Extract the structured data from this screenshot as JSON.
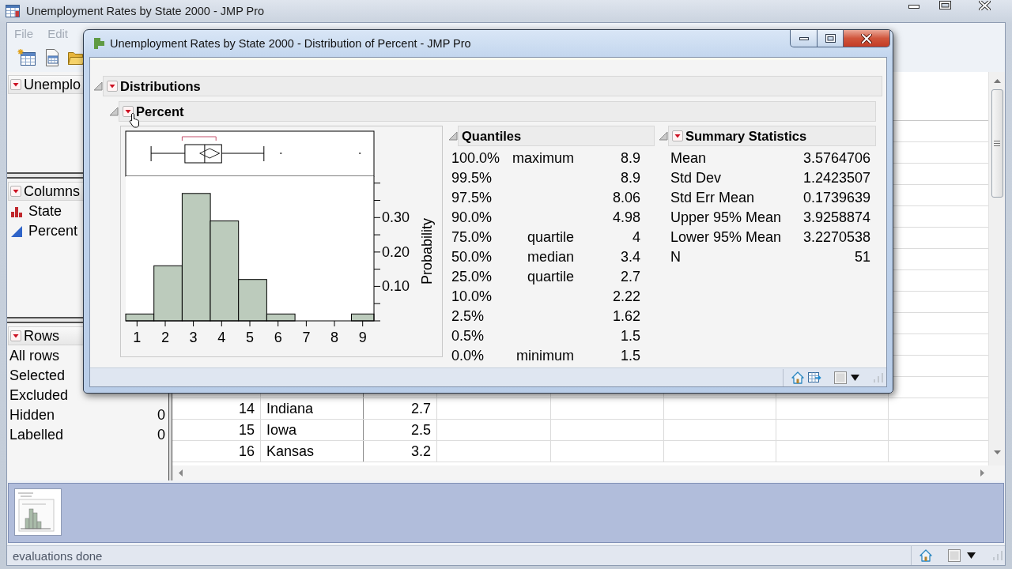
{
  "window": {
    "title": "Unemployment Rates by State 2000 - JMP Pro"
  },
  "menu_bar": [
    {
      "label": "File",
      "disabled": true
    },
    {
      "label": "Edit",
      "disabled": true
    }
  ],
  "table_panel": {
    "title": "Unemplo"
  },
  "columns_panel": {
    "title": "Columns",
    "columns": [
      {
        "name": "State",
        "kind": "nominal"
      },
      {
        "name": "Percent",
        "kind": "continuous"
      }
    ]
  },
  "rows_panel": {
    "title": "Rows",
    "stats": [
      {
        "label": "All rows"
      },
      {
        "label": "Selected"
      },
      {
        "label": "Excluded"
      },
      {
        "label": "Hidden",
        "value": "0"
      },
      {
        "label": "Labelled",
        "value": "0"
      }
    ]
  },
  "data_table": {
    "rows": [
      {
        "row_number": "14",
        "cells": [
          "Indiana",
          "2.7"
        ]
      },
      {
        "row_number": "15",
        "cells": [
          "Iowa",
          "2.5"
        ]
      },
      {
        "row_number": "16",
        "cells": [
          "Kansas",
          "3.2"
        ]
      }
    ]
  },
  "status_bar": {
    "text": "evaluations done"
  },
  "report_window": {
    "title": "Unemployment Rates by State 2000 - Distribution of Percent - JMP Pro",
    "report": {
      "title": "Distributions",
      "expanded": true,
      "variable": {
        "title": "Percent",
        "expanded": true,
        "chart_data": {
          "type": "bar",
          "ylabel": "Probability",
          "x": [
            1.1,
            2.1,
            3.1,
            4.1,
            5.1,
            6.1,
            7.1,
            8.1,
            9.1
          ],
          "values": [
            0.02,
            0.16,
            0.37,
            0.29,
            0.12,
            0.02,
            0,
            0,
            0.02
          ],
          "xlim": [
            0.6,
            9.4
          ],
          "ylim": [
            0,
            0.42
          ],
          "xticks": [
            1,
            2,
            3,
            4,
            5,
            6,
            7,
            8,
            9
          ],
          "yticks": [
            {
              "value": 0.1,
              "label": "0.10"
            },
            {
              "value": 0.2,
              "label": "0.20"
            },
            {
              "value": 0.3,
              "label": "0.30"
            }
          ]
        },
        "quantiles": {
          "title": "Quantiles",
          "expanded": true,
          "rows": [
            {
              "percent": "100.0%",
              "label": "maximum",
              "value": "8.9"
            },
            {
              "percent": "99.5%",
              "value": "8.9"
            },
            {
              "percent": "97.5%",
              "value": "8.06"
            },
            {
              "percent": "90.0%",
              "value": "4.98"
            },
            {
              "percent": "75.0%",
              "label": "quartile",
              "value": "4"
            },
            {
              "percent": "50.0%",
              "label": "median",
              "value": "3.4"
            },
            {
              "percent": "25.0%",
              "label": "quartile",
              "value": "2.7"
            },
            {
              "percent": "10.0%",
              "value": "2.22"
            },
            {
              "percent": "2.5%",
              "value": "1.62"
            },
            {
              "percent": "0.5%",
              "value": "1.5"
            },
            {
              "percent": "0.0%",
              "label": "minimum",
              "value": "1.5"
            }
          ]
        },
        "summary_statistics": {
          "title": "Summary Statistics",
          "expanded": true,
          "rows": [
            {
              "label": "Mean",
              "value": "3.5764706"
            },
            {
              "label": "Std Dev",
              "value": "1.2423507"
            },
            {
              "label": "Std Err Mean",
              "value": "0.1739639"
            },
            {
              "label": "Upper 95% Mean",
              "value": "3.9258874"
            },
            {
              "label": "Lower 95% Mean",
              "value": "3.2270538"
            },
            {
              "label": "N",
              "value": "51"
            }
          ]
        }
      }
    }
  }
}
